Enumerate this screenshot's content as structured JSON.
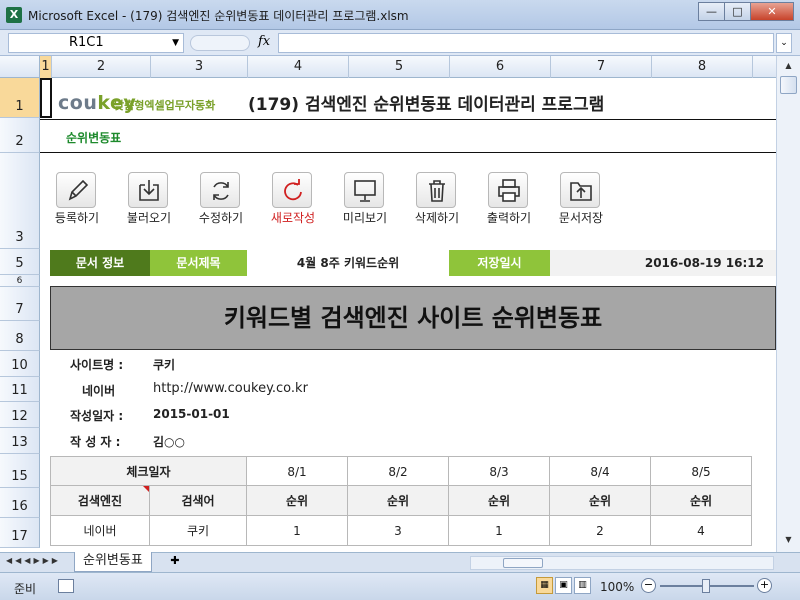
{
  "window": {
    "title": "Microsoft Excel - (179) 검색엔진 순위변동표 데이터관리 프로그램.xlsm",
    "app_icon_letter": "X",
    "minimize": "—",
    "maximize": "□",
    "close": "✕"
  },
  "formula_bar": {
    "name_box": "R1C1",
    "fx": "fx",
    "content": ""
  },
  "columns": [
    "1",
    "2",
    "3",
    "4",
    "5",
    "6",
    "7",
    "8"
  ],
  "rows": [
    "1",
    "2",
    "3",
    "5",
    "6",
    "7",
    "8",
    "10",
    "11",
    "12",
    "13",
    "15",
    "16",
    "17"
  ],
  "header": {
    "logo_main": "cou",
    "logo_accent": "key",
    "logo_sub": "맞춤형엑셀업무자동화",
    "title": "(179) 검색엔진 순위변동표 데이터관리 프로그램",
    "sheet_link": "순위변동표"
  },
  "toolbar": [
    {
      "label": "등록하기",
      "icon": "pencil-icon",
      "red": false
    },
    {
      "label": "불러오기",
      "icon": "import-icon",
      "red": false
    },
    {
      "label": "수정하기",
      "icon": "refresh-icon",
      "red": false
    },
    {
      "label": "새로작성",
      "icon": "new-icon",
      "red": true
    },
    {
      "label": "미리보기",
      "icon": "monitor-icon",
      "red": false
    },
    {
      "label": "삭제하기",
      "icon": "trash-icon",
      "red": false
    },
    {
      "label": "출력하기",
      "icon": "printer-icon",
      "red": false
    },
    {
      "label": "문서저장",
      "icon": "save-folder-icon",
      "red": false
    }
  ],
  "doc_info": {
    "label": "문서 정보",
    "title_label": "문서제목",
    "title_value": "4월 8주 키워드순위",
    "saved_label": "저장일시",
    "saved_value": "2016-08-19 16:12"
  },
  "big_title": "키워드별 검색엔진 사이트 순위변동표",
  "site_info": {
    "site_label": "사이트명 :",
    "site_value": "쿠키",
    "naver_label": "네이버",
    "naver_value": "http://www.coukey.co.kr",
    "date_label": "작성일자 :",
    "date_value": "2015-01-01",
    "author_label": "작 성 자 :",
    "author_value": "김○○"
  },
  "table": {
    "check_date_label": "체크일자",
    "dates": [
      "8/1",
      "8/2",
      "8/3",
      "8/4",
      "8/5"
    ],
    "engine_label": "검색엔진",
    "keyword_label": "검색어",
    "rank_label": "순위",
    "rows": [
      {
        "engine": "네이버",
        "keyword": "쿠키",
        "ranks": [
          "1",
          "3",
          "1",
          "2",
          "4"
        ]
      }
    ]
  },
  "tabs": {
    "active": "순위변동표"
  },
  "status": {
    "ready": "준비",
    "zoom": "100%"
  }
}
